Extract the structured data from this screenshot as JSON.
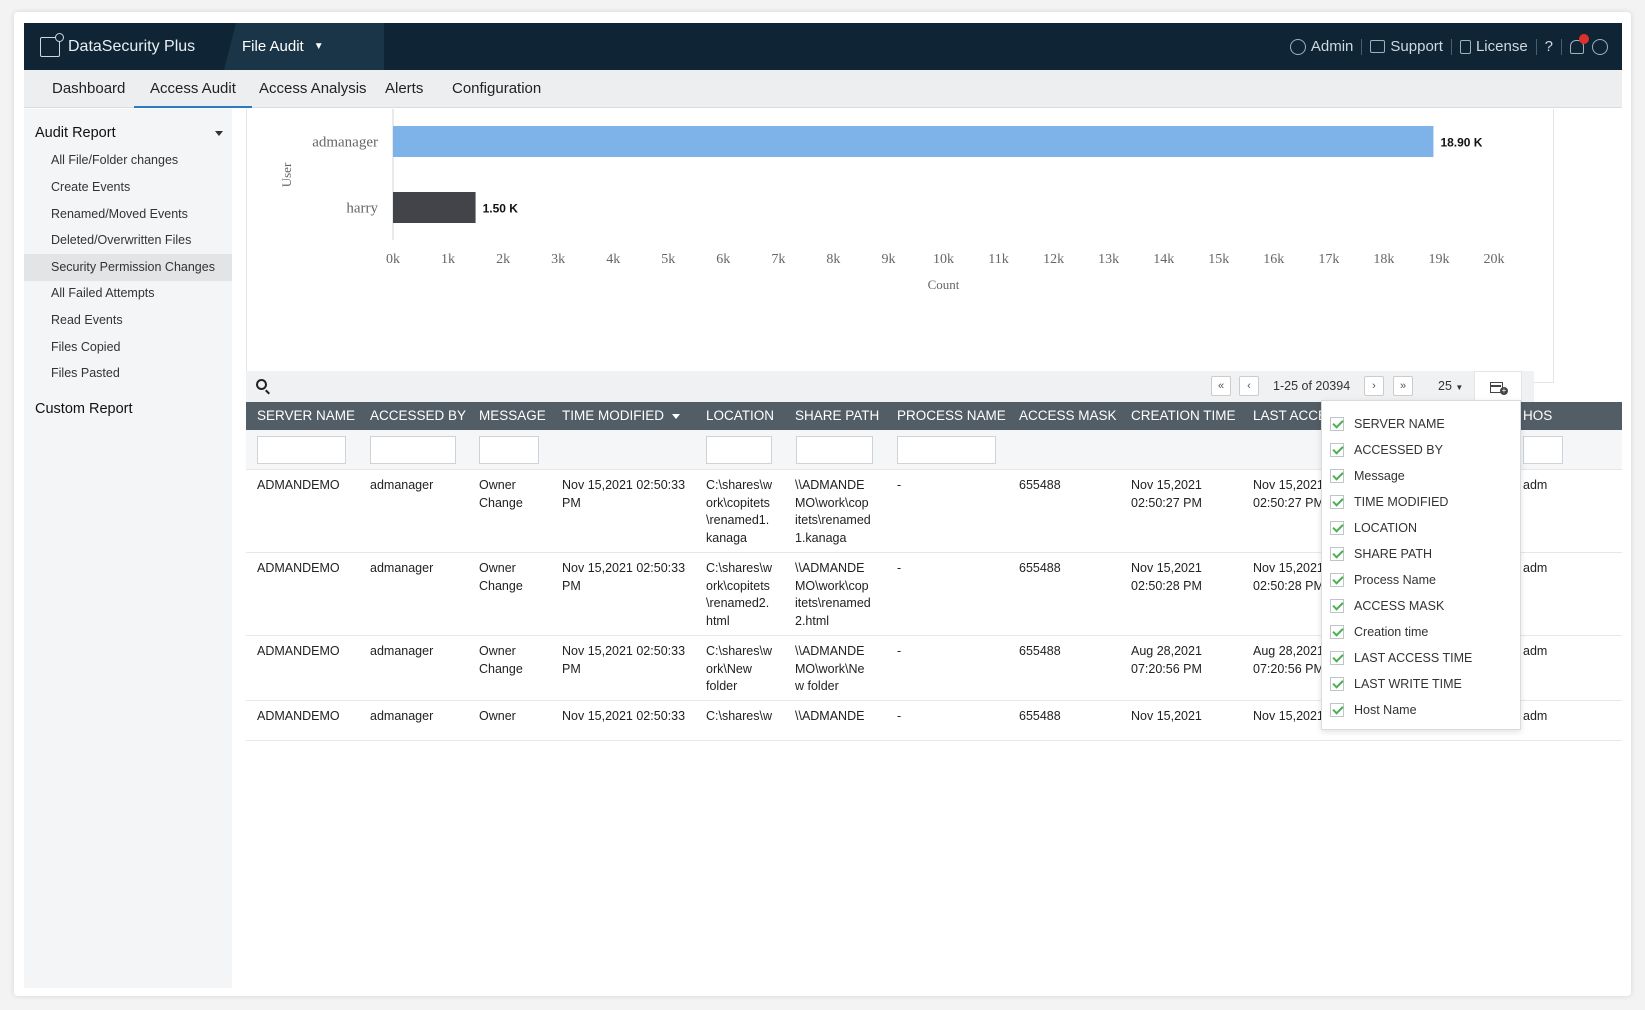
{
  "app": {
    "brand": "DataSecurity Plus",
    "module": "File Audit",
    "links": {
      "admin": "Admin",
      "support": "Support",
      "license": "License",
      "help": "?"
    }
  },
  "nav": {
    "tabs": [
      "Dashboard",
      "Access Audit",
      "Access Analysis",
      "Alerts",
      "Configuration"
    ],
    "active": "Access Audit"
  },
  "sidebar": {
    "audit_report": "Audit Report",
    "items": [
      "All File/Folder changes",
      "Create Events",
      "Renamed/Moved Events",
      "Deleted/Overwritten Files",
      "Security Permission Changes",
      "All Failed Attempts",
      "Read Events",
      "Files Copied",
      "Files Pasted"
    ],
    "active_item": "Security Permission Changes",
    "custom_report": "Custom Report"
  },
  "chart_data": {
    "type": "bar",
    "orientation": "horizontal",
    "categories": [
      "admanager",
      "harry"
    ],
    "values": [
      18900,
      1500
    ],
    "value_labels": [
      "18.90 K",
      "1.50 K"
    ],
    "colors": [
      "#7db3e8",
      "#424449"
    ],
    "xlabel": "Count",
    "ylabel": "User",
    "xlim": [
      0,
      20000
    ],
    "xticks": [
      "0k",
      "1k",
      "2k",
      "3k",
      "4k",
      "5k",
      "6k",
      "7k",
      "8k",
      "9k",
      "10k",
      "11k",
      "12k",
      "13k",
      "14k",
      "15k",
      "16k",
      "17k",
      "18k",
      "19k",
      "20k"
    ]
  },
  "pagination": {
    "range": "1-25 of 20394",
    "page_size": "25"
  },
  "table": {
    "columns": [
      "SERVER NAME",
      "ACCESSED BY",
      "MESSAGE",
      "TIME MODIFIED",
      "LOCATION",
      "SHARE PATH",
      "PROCESS NAME",
      "ACCESS MASK",
      "CREATION TIME",
      "LAST ACCESS TIME",
      "HOST NAME"
    ],
    "visible_headers": [
      "SERVER NAME",
      "ACCESSED BY",
      "MESSAGE",
      "TIME MODIFIED",
      "LOCATION",
      "SHARE PATH",
      "PROCESS NAME",
      "ACCESS MASK",
      "CREATION TIME",
      "LAST ACCES",
      "HOS"
    ],
    "rows": [
      [
        "ADMANDEMO",
        "admanager",
        "Owner\nChange",
        "Nov 15,2021 02:50:33\nPM",
        "C:\\shares\\w\nork\\copitets\n\\renamed1.\nkanaga",
        "\\\\ADMANDE\nMO\\work\\cop\nitets\\renamed\n1.kanaga",
        "-",
        "655488",
        "Nov 15,2021\n02:50:27 PM",
        "Nov 15,2021\n02:50:27 PM",
        "adm"
      ],
      [
        "ADMANDEMO",
        "admanager",
        "Owner\nChange",
        "Nov 15,2021 02:50:33\nPM",
        "C:\\shares\\w\nork\\copitets\n\\renamed2.\nhtml",
        "\\\\ADMANDE\nMO\\work\\cop\nitets\\renamed\n2.html",
        "-",
        "655488",
        "Nov 15,2021\n02:50:28 PM",
        "Nov 15,2021\n02:50:28 PM",
        "adm"
      ],
      [
        "ADMANDEMO",
        "admanager",
        "Owner\nChange",
        "Nov 15,2021 02:50:33\nPM",
        "C:\\shares\\w\nork\\New\nfolder",
        "\\\\ADMANDE\nMO\\work\\Ne\nw folder",
        "-",
        "655488",
        "Aug 28,2021\n07:20:56 PM",
        "Aug 28,2021\n07:20:56 PM",
        "adm"
      ],
      [
        "ADMANDEMO",
        "admanager",
        "Owner",
        "Nov 15,2021 02:50:33",
        "C:\\shares\\w",
        "\\\\ADMANDE",
        "-",
        "655488",
        "Nov 15,2021",
        "Nov 15,2021",
        "adm"
      ]
    ]
  },
  "column_menu": {
    "items": [
      "SERVER NAME",
      "ACCESSED BY",
      "Message",
      "TIME MODIFIED",
      "LOCATION",
      "SHARE PATH",
      "Process Name",
      "ACCESS MASK",
      "Creation time",
      "LAST ACCESS TIME",
      "LAST WRITE TIME",
      "Host Name"
    ],
    "checked": [
      true,
      true,
      true,
      true,
      true,
      true,
      true,
      true,
      true,
      true,
      true,
      true
    ]
  }
}
